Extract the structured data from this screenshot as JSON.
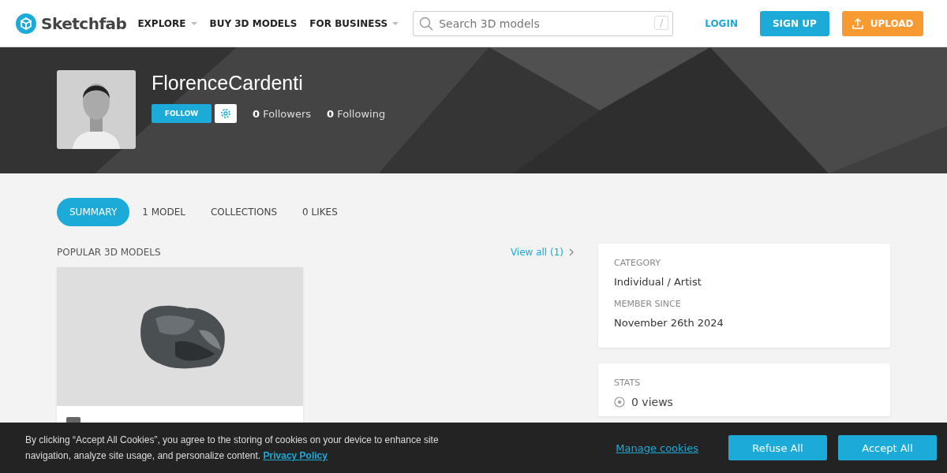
{
  "header": {
    "logo": "Sketchfab",
    "nav": [
      {
        "label": "EXPLORE",
        "dropdown": true
      },
      {
        "label": "BUY 3D MODELS",
        "dropdown": false
      },
      {
        "label": "FOR BUSINESS",
        "dropdown": true
      }
    ],
    "search": {
      "placeholder": "Search 3D models",
      "shortcut": "/"
    },
    "login": "LOGIN",
    "signup": "SIGN UP",
    "upload": "UPLOAD"
  },
  "profile": {
    "username": "FlorenceCardenti",
    "follow": "FOLLOW",
    "stats": [
      {
        "count": "0",
        "label": "Followers"
      },
      {
        "count": "0",
        "label": "Following"
      }
    ]
  },
  "tabs": [
    {
      "label": "SUMMARY",
      "selected": true
    },
    {
      "label": "1 MODEL",
      "selected": false
    },
    {
      "label": "COLLECTIONS",
      "selected": false
    },
    {
      "label": "0 LIKES",
      "selected": false
    }
  ],
  "popular": {
    "title": "POPULAR 3D MODELS",
    "view_all": "View all (1)"
  },
  "info": [
    {
      "label": "CATEGORY",
      "value": "Individual / Artist"
    },
    {
      "label": "MEMBER SINCE",
      "value": "November 26th 2024"
    }
  ],
  "stats": {
    "title": "STATS",
    "views": "0 views"
  },
  "cookie_banner": {
    "text": "By clicking “Accept All Cookies”, you agree to the storing of cookies on your device to enhance site navigation, analyze site usage, and personalize content.",
    "policy": "Privacy Policy",
    "manage": "Manage cookies",
    "refuse": "Refuse All",
    "accept": "Accept All"
  }
}
